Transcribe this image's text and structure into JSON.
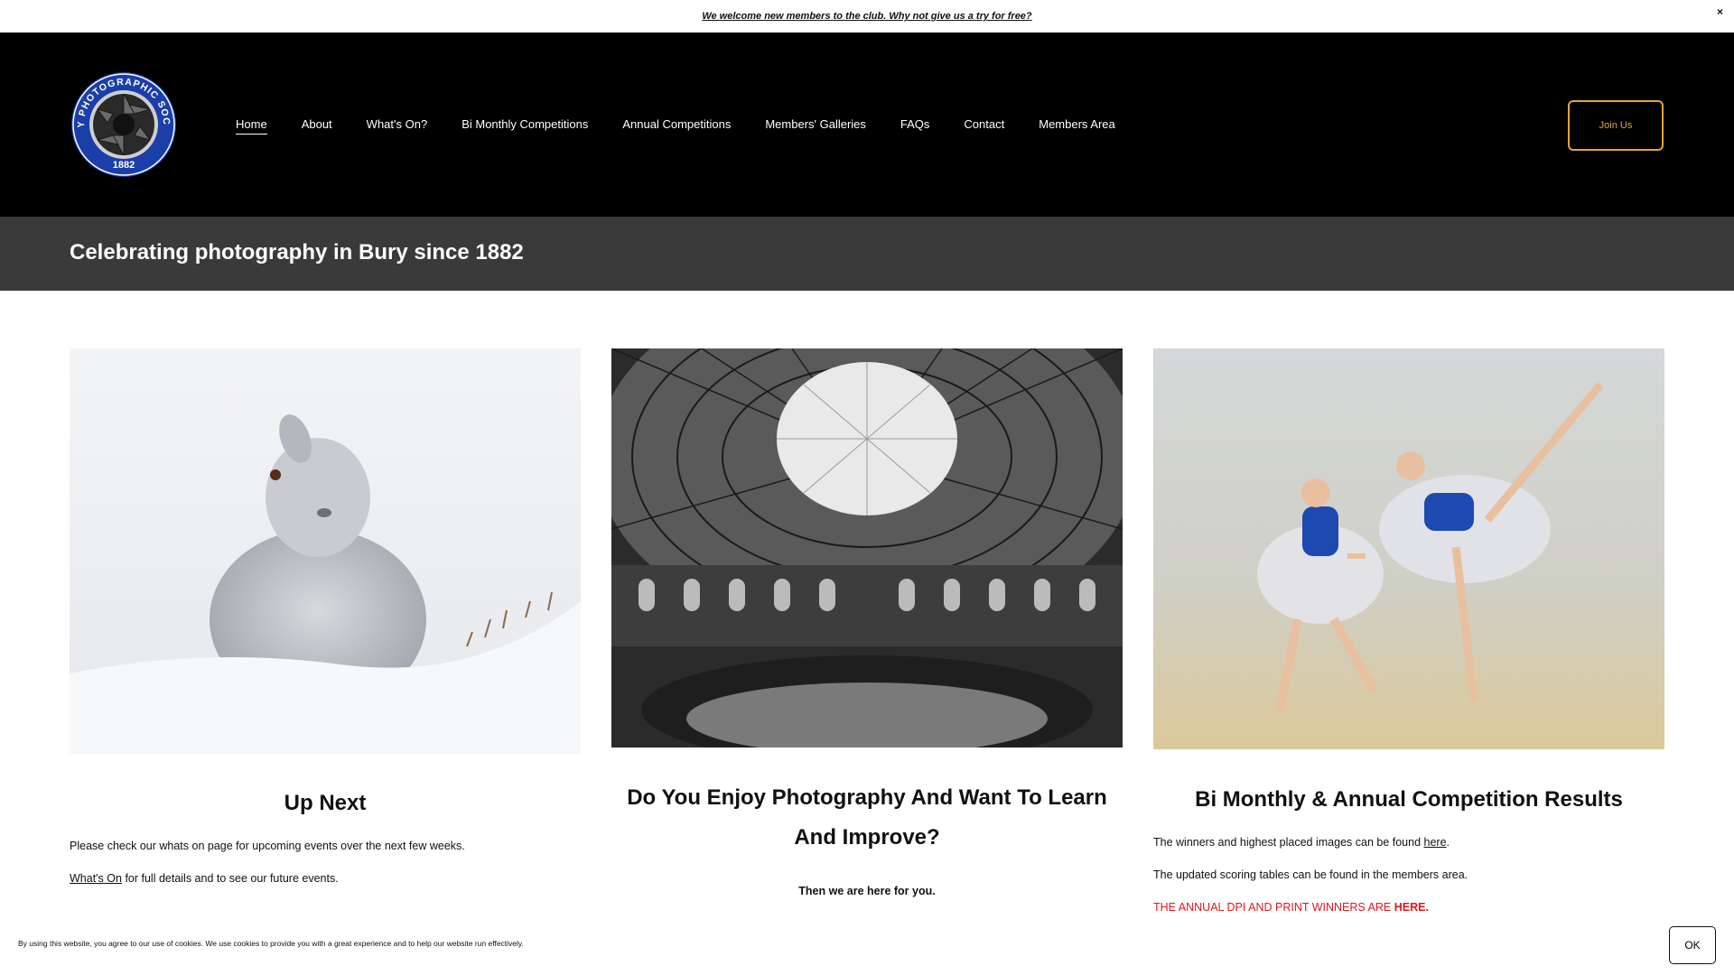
{
  "announcement": {
    "text": "We welcome new members to the club. Why not give us a try for free?",
    "close": "×"
  },
  "logo": {
    "top_text": "BURY PHOTOGRAPHIC SOCIETY",
    "year": "1882"
  },
  "nav": {
    "items": [
      "Home",
      "About",
      "What's On?",
      "Bi Monthly Competitions",
      "Annual Competitions",
      "Members' Galleries",
      "FAQs",
      "Contact",
      "Members Area"
    ],
    "active": "Home"
  },
  "header": {
    "join_label": "Join Us",
    "accent": "#e6a72c"
  },
  "tagline": "Celebrating photography in Bury since 1882",
  "columns": {
    "up_next": {
      "title": "Up Next",
      "para1": "Please check our whats on page for upcoming events over the next few weeks.",
      "link": "What's On",
      "para2_rest": " for full details and to see our future events."
    },
    "learn": {
      "title": "Do You Enjoy Photography And Want To Learn And Improve?",
      "subtitle": "Then we are here for you."
    },
    "results": {
      "title": "Bi Monthly & Annual Competition Results",
      "para1_pre": "The winners and highest placed images can be found ",
      "para1_link": "here",
      "para1_post": ".",
      "para2": "The updated scoring tables can be found in the members area.",
      "para3_pre": "THE ANNUAL DPI AND PRINT WINNERS ARE ",
      "para3_link": "HERE.",
      "highlight_color": "#e3161c"
    }
  },
  "cookie": {
    "text": "By using this website, you agree to our use of cookies. We use cookies to provide you with a great experience and to help our website run effectively.",
    "ok_label": "OK"
  }
}
